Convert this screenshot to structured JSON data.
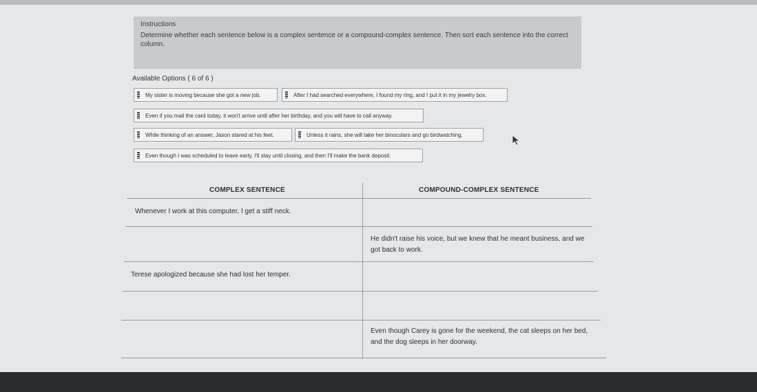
{
  "instructions": {
    "heading": "Instructions",
    "body": "Determine whether each sentence below is a complex sentence or a compound-complex sentence. Then sort each sentence into the correct column."
  },
  "options": {
    "label": "Available Options ( 6 of 6 )",
    "items": [
      "My sister is moving because she got a new job.",
      "After I had searched everywhere, I found my ring, and I put it in my jewelry box.",
      "Even if you mail the card today, it won't arrive until after her birthday, and you will have to call anyway.",
      "While thinking of an answer, Jason stared at his feet.",
      "Unless it rains, she will take her binoculars and go birdwatching.",
      "Even though I was scheduled to leave early, I'll stay until closing, and then I'll make the bank deposit."
    ]
  },
  "table": {
    "headers": [
      "COMPLEX SENTENCE",
      "COMPOUND-COMPLEX SENTENCE"
    ],
    "complex": [
      "Whenever I work at this computer, I get a stiff neck.",
      "",
      "Terese apologized because she had lost her temper.",
      "",
      ""
    ],
    "compound_complex": [
      "",
      "He didn't raise his voice, but we knew that he meant business, and we got back to work.",
      "",
      "",
      "Even though Carey is gone for the weekend, the cat sleeps on her bed, and the dog sleeps in her doorway."
    ]
  },
  "icons": {
    "drag_handle": "drag-handle-icon",
    "cursor": "mouse-cursor-icon"
  }
}
